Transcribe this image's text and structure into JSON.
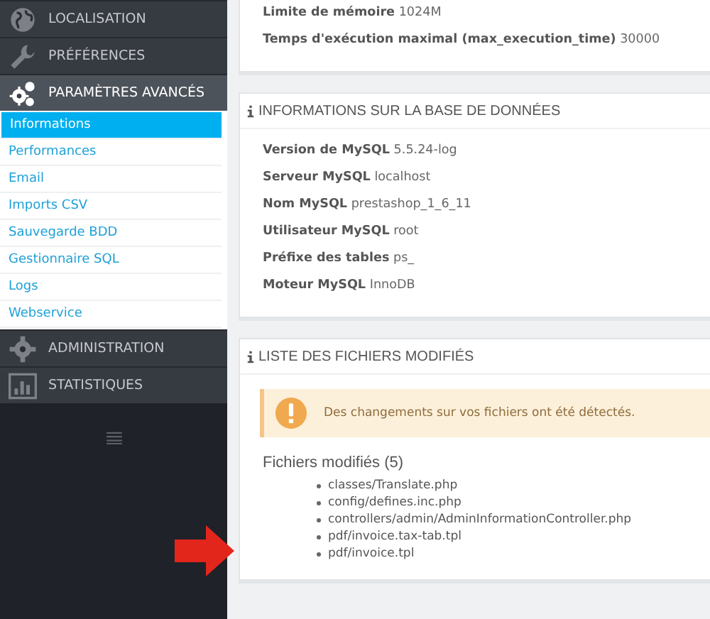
{
  "sidebar": {
    "items": [
      {
        "label": "LOCALISATION",
        "selected": false
      },
      {
        "label": "PRÉFÉRENCES",
        "selected": false
      },
      {
        "label": "PARAMÈTRES AVANCÉS",
        "selected": true,
        "children": [
          {
            "label": "Informations",
            "selected": true
          },
          {
            "label": "Performances",
            "selected": false
          },
          {
            "label": "Email",
            "selected": false
          },
          {
            "label": "Imports CSV",
            "selected": false
          },
          {
            "label": "Sauvegarde BDD",
            "selected": false
          },
          {
            "label": "Gestionnaire SQL",
            "selected": false
          },
          {
            "label": "Logs",
            "selected": false
          },
          {
            "label": "Webservice",
            "selected": false
          }
        ]
      },
      {
        "label": "ADMINISTRATION",
        "selected": false
      },
      {
        "label": "STATISTIQUES",
        "selected": false
      }
    ]
  },
  "panels": [
    {
      "rows": [
        {
          "label": "Limite de mémoire",
          "value": "1024M"
        },
        {
          "label": "Temps d'exécution maximal (max_execution_time)",
          "value": "30000"
        }
      ]
    },
    {
      "title": "INFORMATIONS SUR LA BASE DE DONNÉES",
      "rows": [
        {
          "label": "Version de MySQL",
          "value": "5.5.24-log"
        },
        {
          "label": "Serveur MySQL",
          "value": "localhost"
        },
        {
          "label": "Nom MySQL",
          "value": "prestashop_1_6_11"
        },
        {
          "label": "Utilisateur MySQL",
          "value": "root"
        },
        {
          "label": "Préfixe des tables",
          "value": "ps_"
        },
        {
          "label": "Moteur MySQL",
          "value": "InnoDB"
        }
      ]
    },
    {
      "title": "LISTE DES FICHIERS MODIFIÉS",
      "alert": "Des changements sur vos fichiers ont été détectés.",
      "subtitle": "Fichiers modifiés (5)",
      "files": [
        "classes/Translate.php",
        "config/defines.inc.php",
        "controllers/admin/AdminInformationController.php",
        "pdf/invoice.tax-tab.tpl",
        "pdf/invoice.tpl"
      ]
    }
  ]
}
